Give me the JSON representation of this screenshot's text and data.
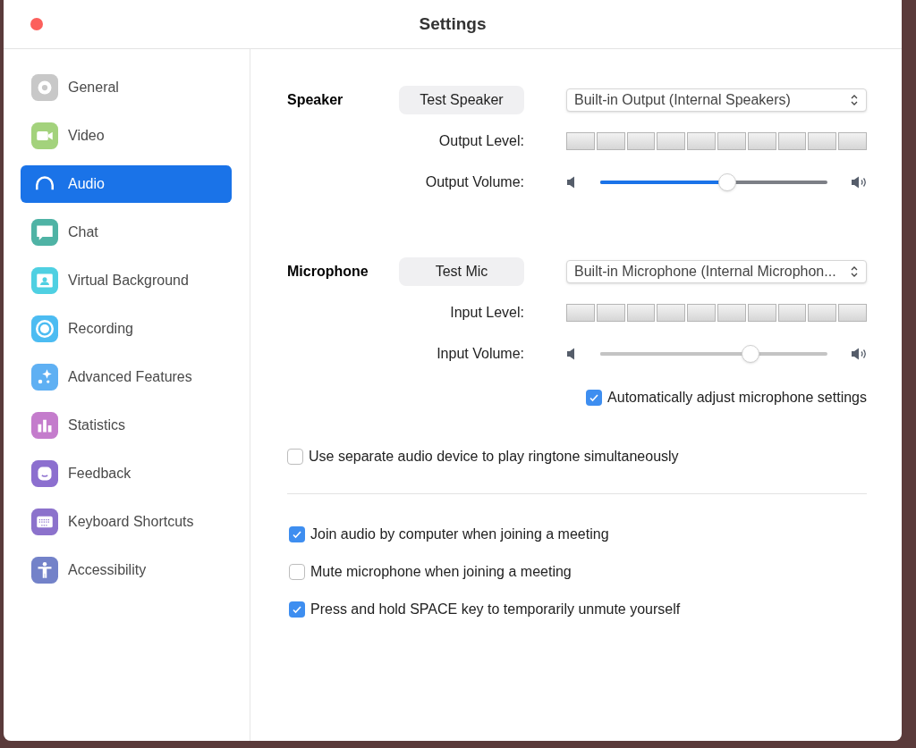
{
  "window": {
    "title": "Settings"
  },
  "sidebar": {
    "items": [
      {
        "label": "General",
        "selected": false,
        "color": "#c8c8c8"
      },
      {
        "label": "Video",
        "selected": false,
        "color": "#a3d27c"
      },
      {
        "label": "Audio",
        "selected": true
      },
      {
        "label": "Chat",
        "selected": false,
        "color": "#4fb3a5"
      },
      {
        "label": "Virtual Background",
        "selected": false,
        "color": "#4fd0e2"
      },
      {
        "label": "Recording",
        "selected": false,
        "color": "#4cbcf2"
      },
      {
        "label": "Advanced Features",
        "selected": false,
        "color": "#5fb0f3"
      },
      {
        "label": "Statistics",
        "selected": false,
        "color": "#c47ccc"
      },
      {
        "label": "Feedback",
        "selected": false,
        "color": "#8c6fcf"
      },
      {
        "label": "Keyboard Shortcuts",
        "selected": false,
        "color": "#8c72cc"
      },
      {
        "label": "Accessibility",
        "selected": false,
        "color": "#7382c9"
      }
    ]
  },
  "speaker": {
    "label": "Speaker",
    "test_button": "Test Speaker",
    "device": "Built-in Output (Internal Speakers)",
    "level_label": "Output Level:",
    "volume_label": "Output Volume:",
    "volume": {
      "level": 0.56,
      "active": true
    }
  },
  "microphone": {
    "label": "Microphone",
    "test_button": "Test Mic",
    "device": "Built-in Microphone (Internal Microphon...",
    "level_label": "Input Level:",
    "volume_label": "Input Volume:",
    "volume": {
      "level": 0.66,
      "active": false
    }
  },
  "auto_adjust": {
    "label": "Automatically adjust microphone settings",
    "checked": true
  },
  "separate_device": {
    "label": "Use separate audio device to play ringtone simultaneously",
    "checked": false
  },
  "options": [
    {
      "label": "Join audio by computer when joining a meeting",
      "checked": true
    },
    {
      "label": "Mute microphone when joining a meeting",
      "checked": false
    },
    {
      "label": "Press and hold SPACE key to temporarily unmute yourself",
      "checked": true
    }
  ]
}
